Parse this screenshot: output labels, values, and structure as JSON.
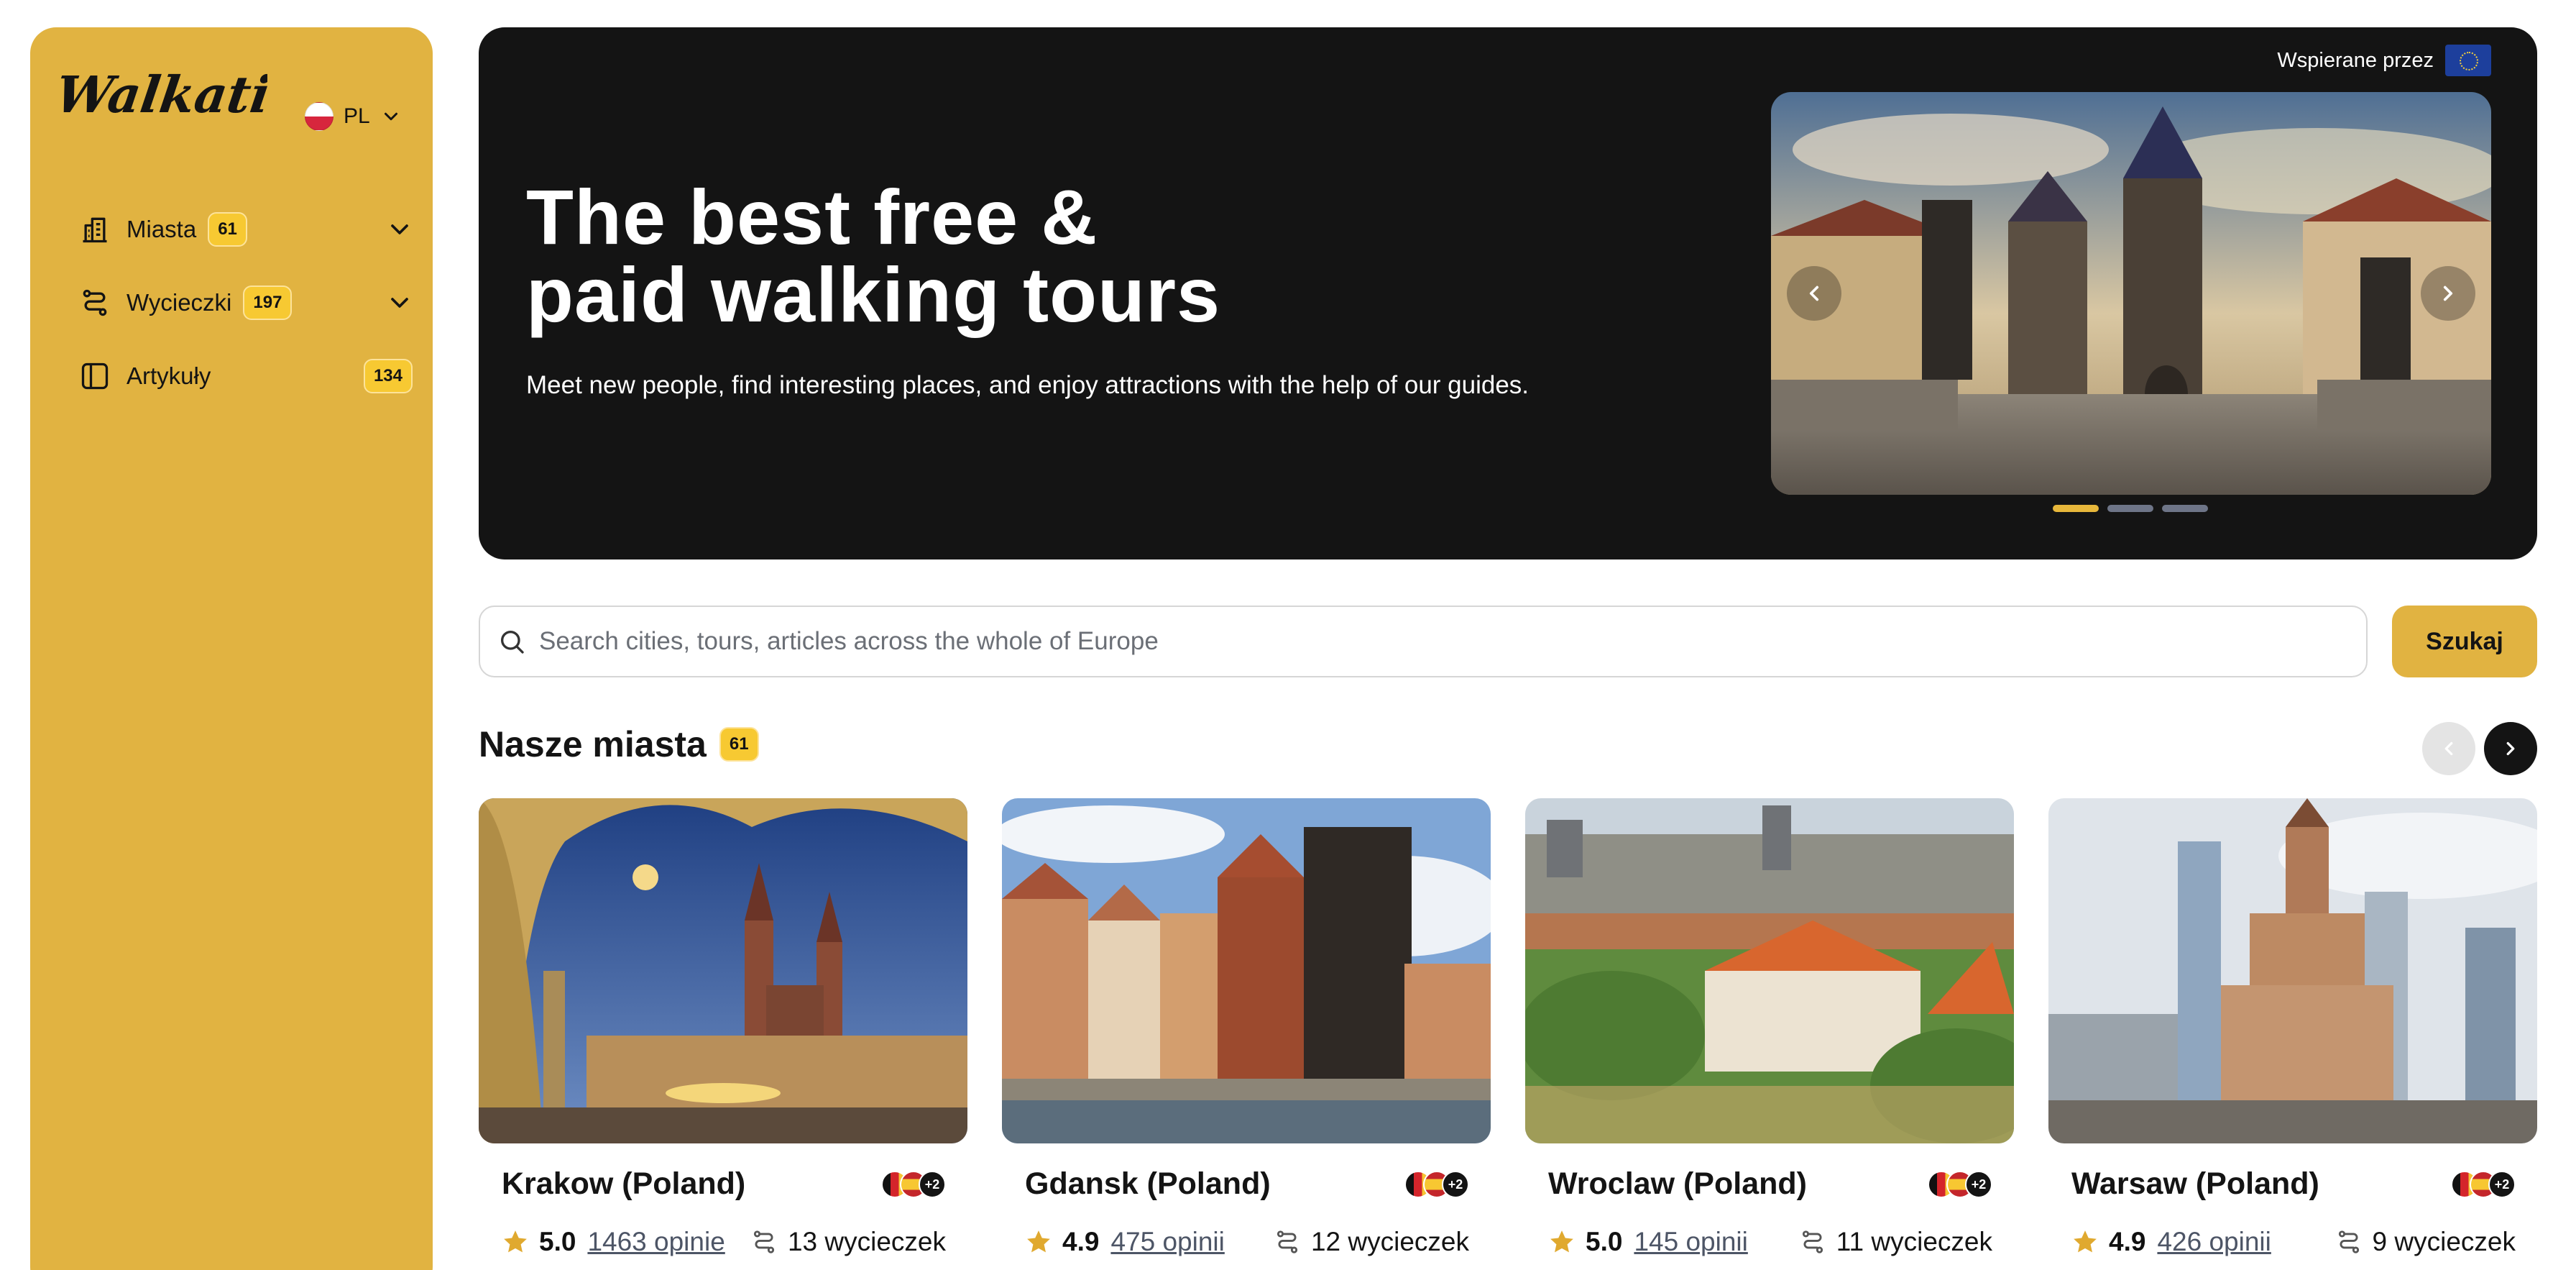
{
  "sidebar": {
    "logo_text": "Walkative!",
    "language": {
      "code": "PL",
      "flag_icon": "poland-flag-icon"
    },
    "items": [
      {
        "label": "Miasta",
        "count": "61",
        "icon": "city-icon"
      },
      {
        "label": "Wycieczki",
        "count": "197",
        "icon": "route-icon"
      },
      {
        "label": "Artykuły",
        "count": "134",
        "icon": "sidebar-panel-icon"
      }
    ],
    "background": "#e1b341"
  },
  "hero": {
    "title": "The best free &\npaid walking tours",
    "subtitle": "Meet new people, find interesting places, and enjoy attractions with the help of our guides.",
    "supported_by": "Wspierane przez",
    "supported_icon": "eu-flag-icon",
    "carousel": {
      "slide_count": 3,
      "active_slide": 1
    }
  },
  "search": {
    "placeholder": "Search cities, tours, articles across the whole of Europe",
    "button_label": "Szukaj"
  },
  "cities": {
    "title": "Nasze miasta",
    "count": "61",
    "items": [
      {
        "name": "Krakow (Poland)",
        "rating": "5.0",
        "reviews": "1463 opinie",
        "tours": "13 wycieczek",
        "more_langs": "+2"
      },
      {
        "name": "Gdansk (Poland)",
        "rating": "4.9",
        "reviews": "475 opinii",
        "tours": "12 wycieczek",
        "more_langs": "+2"
      },
      {
        "name": "Wroclaw (Poland)",
        "rating": "5.0",
        "reviews": "145 opinii",
        "tours": "11 wycieczek",
        "more_langs": "+2"
      },
      {
        "name": "Warsaw (Poland)",
        "rating": "4.9",
        "reviews": "426 opinii",
        "tours": "9 wycieczek",
        "more_langs": "+2"
      }
    ]
  },
  "colors": {
    "accent": "#e1b341",
    "dark": "#141414",
    "badge": "#f7c932",
    "star": "#e0a92f"
  }
}
